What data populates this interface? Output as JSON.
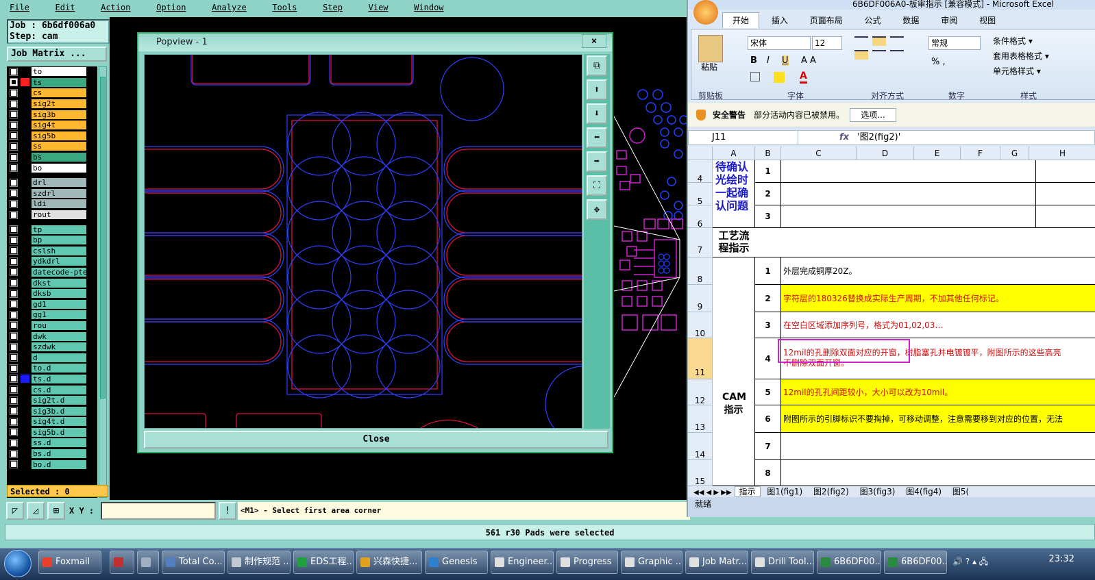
{
  "genesis": {
    "menu": [
      "File",
      "Edit",
      "Action",
      "Option",
      "Analyze",
      "Tools",
      "Step",
      "View",
      "Window"
    ],
    "job_label": "Job : 6b6df006a0",
    "step_label": "Step: cam",
    "job_matrix_btn": "Job Matrix ...",
    "selected_text": "Selected : 0",
    "xy_label": "X Y :",
    "prompt_msg": "<M1> - Select first area corner",
    "status_text": "561 r30 Pads were selected",
    "layers_board": [
      {
        "name": "to",
        "bg": "#ffffff",
        "color": "#000000",
        "checked": false
      },
      {
        "name": "ts",
        "bg": "#3aa880",
        "color": "#ff2020",
        "checked": true
      },
      {
        "name": "cs",
        "bg": "#ffb830",
        "color": "#000000",
        "checked": false
      },
      {
        "name": "sig2t",
        "bg": "#ffb830",
        "color": "#000000",
        "checked": false
      },
      {
        "name": "sig3b",
        "bg": "#ffb830",
        "color": "#000000",
        "checked": false
      },
      {
        "name": "sig4t",
        "bg": "#ffb830",
        "color": "#000000",
        "checked": false
      },
      {
        "name": "sig5b",
        "bg": "#ffb830",
        "color": "#000000",
        "checked": false
      },
      {
        "name": "ss",
        "bg": "#ffb830",
        "color": "#000000",
        "checked": false
      },
      {
        "name": "bs",
        "bg": "#3aa880",
        "color": "#000000",
        "checked": false
      },
      {
        "name": "bo",
        "bg": "#ffffff",
        "color": "#000000",
        "checked": false
      }
    ],
    "layers_drill": [
      {
        "name": "drl",
        "bg": "#a0b8b8"
      },
      {
        "name": "szdrl",
        "bg": "#a0b8b8"
      },
      {
        "name": "ldi",
        "bg": "#a0b8b8"
      },
      {
        "name": "rout",
        "bg": "#e0e0e0"
      }
    ],
    "layers_misc": [
      {
        "name": "tp",
        "bg": "#60c8b0",
        "color": "#000000"
      },
      {
        "name": "bp",
        "bg": "#60c8b0",
        "color": "#000000"
      },
      {
        "name": "cslsh",
        "bg": "#60c8b0",
        "color": "#000000"
      },
      {
        "name": "ydkdrl",
        "bg": "#60c8b0",
        "color": "#000000"
      },
      {
        "name": "datecode-pte",
        "bg": "#60c8b0",
        "color": "#000000"
      },
      {
        "name": "dkst",
        "bg": "#60c8b0",
        "color": "#000000"
      },
      {
        "name": "dksb",
        "bg": "#60c8b0",
        "color": "#000000"
      },
      {
        "name": "gd1",
        "bg": "#60c8b0",
        "color": "#000000"
      },
      {
        "name": "gg1",
        "bg": "#60c8b0",
        "color": "#000000"
      },
      {
        "name": "rou",
        "bg": "#60c8b0",
        "color": "#000000"
      },
      {
        "name": "dwk",
        "bg": "#60c8b0",
        "color": "#000000"
      },
      {
        "name": "szdwk",
        "bg": "#60c8b0",
        "color": "#000000"
      },
      {
        "name": "d",
        "bg": "#60c8b0",
        "color": "#000000"
      },
      {
        "name": "to.d",
        "bg": "#60c8b0",
        "color": "#000000"
      },
      {
        "name": "ts.d",
        "bg": "#60c8b0",
        "color": "#1a1aff"
      },
      {
        "name": "cs.d",
        "bg": "#60c8b0",
        "color": "#000000"
      },
      {
        "name": "sig2t.d",
        "bg": "#60c8b0",
        "color": "#000000"
      },
      {
        "name": "sig3b.d",
        "bg": "#60c8b0",
        "color": "#000000"
      },
      {
        "name": "sig4t.d",
        "bg": "#60c8b0",
        "color": "#000000"
      },
      {
        "name": "sig5b.d",
        "bg": "#60c8b0",
        "color": "#000000"
      },
      {
        "name": "ss.d",
        "bg": "#60c8b0",
        "color": "#000000"
      },
      {
        "name": "bs.d",
        "bg": "#60c8b0",
        "color": "#000000"
      },
      {
        "name": "bo.d",
        "bg": "#60c8b0",
        "color": "#000000"
      }
    ]
  },
  "popview": {
    "title": "Popview - 1",
    "close_x": "×",
    "close_label": "Close"
  },
  "excel": {
    "title": "6B6DF006A0-板审指示 [兼容模式] - Microsoft Excel",
    "tabs": [
      "开始",
      "插入",
      "页面布局",
      "公式",
      "数据",
      "审阅",
      "视图"
    ],
    "font_name": "宋体",
    "font_size": "12",
    "number_format": "常规",
    "paste_label": "粘贴",
    "cond_format": "条件格式 ▾",
    "table_format": "套用表格格式 ▾",
    "cell_style": "单元格样式 ▾",
    "groups": [
      "剪贴板",
      "字体",
      "对齐方式",
      "数字",
      "样式"
    ],
    "security_title": "安全警告",
    "security_msg": "部分活动内容已被禁用。",
    "security_btn": "选项...",
    "name_box": "J11",
    "fx": "fx",
    "formula": "'图2(fig2)'",
    "col_headers": [
      "A",
      "B",
      "C",
      "D",
      "E",
      "F",
      "G",
      "H"
    ],
    "row_numbers": [
      "4",
      "5",
      "6",
      "7",
      "8",
      "9",
      "10",
      "11",
      "12",
      "13",
      "14",
      "15"
    ],
    "section_a1": "待确认光绘时一起确认问题",
    "section_a2": "工艺流程指示",
    "section_a3": "CAM指示",
    "b_items": [
      "1",
      "2",
      "3",
      "1",
      "2",
      "3",
      "4",
      "5",
      "6",
      "7",
      "8"
    ],
    "rows_text": [
      "外层完成铜厚20Z。",
      "字符层的180326替换成实际生产周期，不加其他任何标记。",
      "在空白区域添加序列号，格式为01,02,03…",
      "12mil的孔删除双面对应的开窗，树脂塞孔并电镀镀平，附图所示的这些高亮",
      "不删除双面开窗。",
      "12mil的孔孔间距较小，大小可以改为10mil。",
      "附图所示的引脚标识不要掏掉，可移动调整，注意需要移到对应的位置，无法"
    ],
    "sheet_tabs": [
      "指示",
      "图1(fig1)",
      "图2(fig2)",
      "图3(fig3)",
      "图4(fig4)",
      "图5("
    ],
    "status_ready": "就绪"
  },
  "taskbar": {
    "items": [
      "Foxmail",
      "",
      "",
      "Total Co...",
      "制作规范 ...",
      "EDS工程...",
      "兴森快捷...",
      "Genesis",
      "Engineer...",
      "Progress",
      "Graphic ...",
      "Job Matr...",
      "Drill Tool...",
      "6B6DF00...",
      "6B6DF00..."
    ],
    "clock": "23:32"
  }
}
